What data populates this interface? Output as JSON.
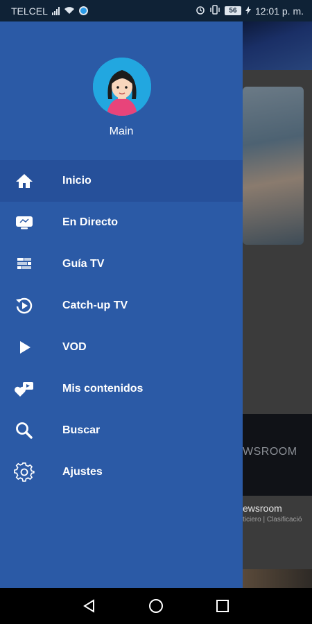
{
  "status_bar": {
    "carrier": "TELCEL",
    "battery": "56",
    "time": "12:01 p. m."
  },
  "background": {
    "card_logo": "WSROOM",
    "card_title": "ewsroom",
    "card_meta": "ticiero | Clasificació"
  },
  "drawer": {
    "profile_name": "Main",
    "menu": [
      {
        "label": "Inicio",
        "icon": "home-icon",
        "active": true
      },
      {
        "label": "En Directo",
        "icon": "tv-icon",
        "active": false
      },
      {
        "label": "Guía TV",
        "icon": "guide-icon",
        "active": false
      },
      {
        "label": "Catch-up TV",
        "icon": "replay-icon",
        "active": false
      },
      {
        "label": "VOD",
        "icon": "play-icon",
        "active": false
      },
      {
        "label": "Mis contenidos",
        "icon": "heart-icon",
        "active": false
      },
      {
        "label": "Buscar",
        "icon": "search-icon",
        "active": false
      },
      {
        "label": "Ajustes",
        "icon": "gear-icon",
        "active": false
      }
    ]
  },
  "colors": {
    "drawer_bg": "#2b5aa6",
    "drawer_active": "#26509a",
    "status_bg": "#0f2236"
  }
}
